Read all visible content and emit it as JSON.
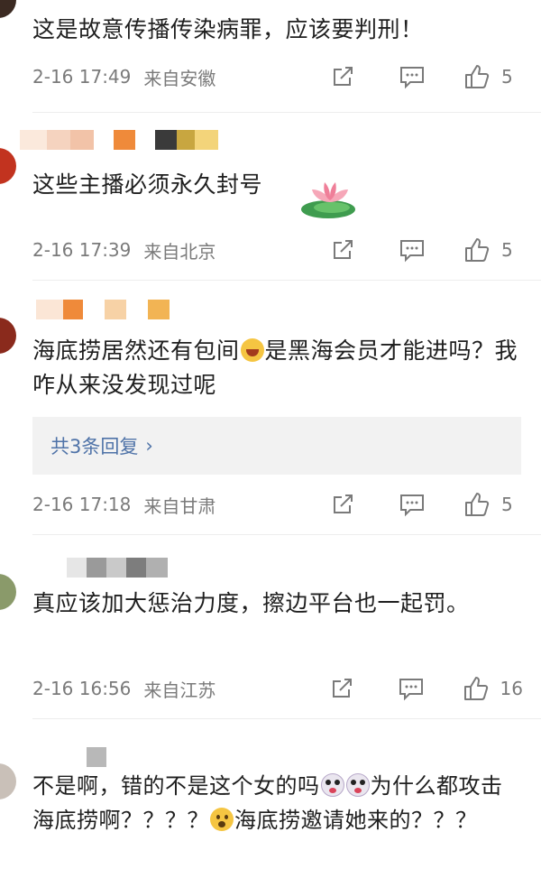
{
  "comments": [
    {
      "text": "这是故意传播传染病罪，应该要判刑！",
      "time": "2-16 17:49",
      "location": "来自安徽",
      "likes": "5"
    },
    {
      "text": "这些主播必须永久封号",
      "time": "2-16 17:39",
      "location": "来自北京",
      "likes": "5",
      "sticker_icon": "lotus-sticker-icon"
    },
    {
      "text_part1": "海底捞居然还有包间",
      "text_part2": "是黑海会员才能进吗？我咋从来没发现过呢",
      "inline_emoji": "laughing-crying-emoji-icon",
      "replies_label": "共3条回复",
      "time": "2-16 17:18",
      "location": "来自甘肃",
      "likes": "5"
    },
    {
      "text": "真应该加大惩治力度，擦边平台也一起罚。",
      "time": "2-16 16:56",
      "location": "来自江苏",
      "likes": "16"
    },
    {
      "text_part1": "不是啊，错的不是这个女的吗",
      "text_part2": "为什么都攻击海底捞啊？？？？",
      "text_part3": "海底捞邀请她来的？？？",
      "inline_emoji_1": "shocked-face-emoji-icon",
      "inline_emoji_2": "worried-face-emoji-icon"
    }
  ],
  "icons": {
    "share": "share-icon",
    "reply": "comment-icon",
    "like": "thumbs-up-icon",
    "replies_chevron": "chevron-right-icon"
  },
  "colors": {
    "link_blue": "#4f73a8",
    "meta_gray": "#7a7a7a",
    "replies_bg": "#f2f2f2"
  }
}
